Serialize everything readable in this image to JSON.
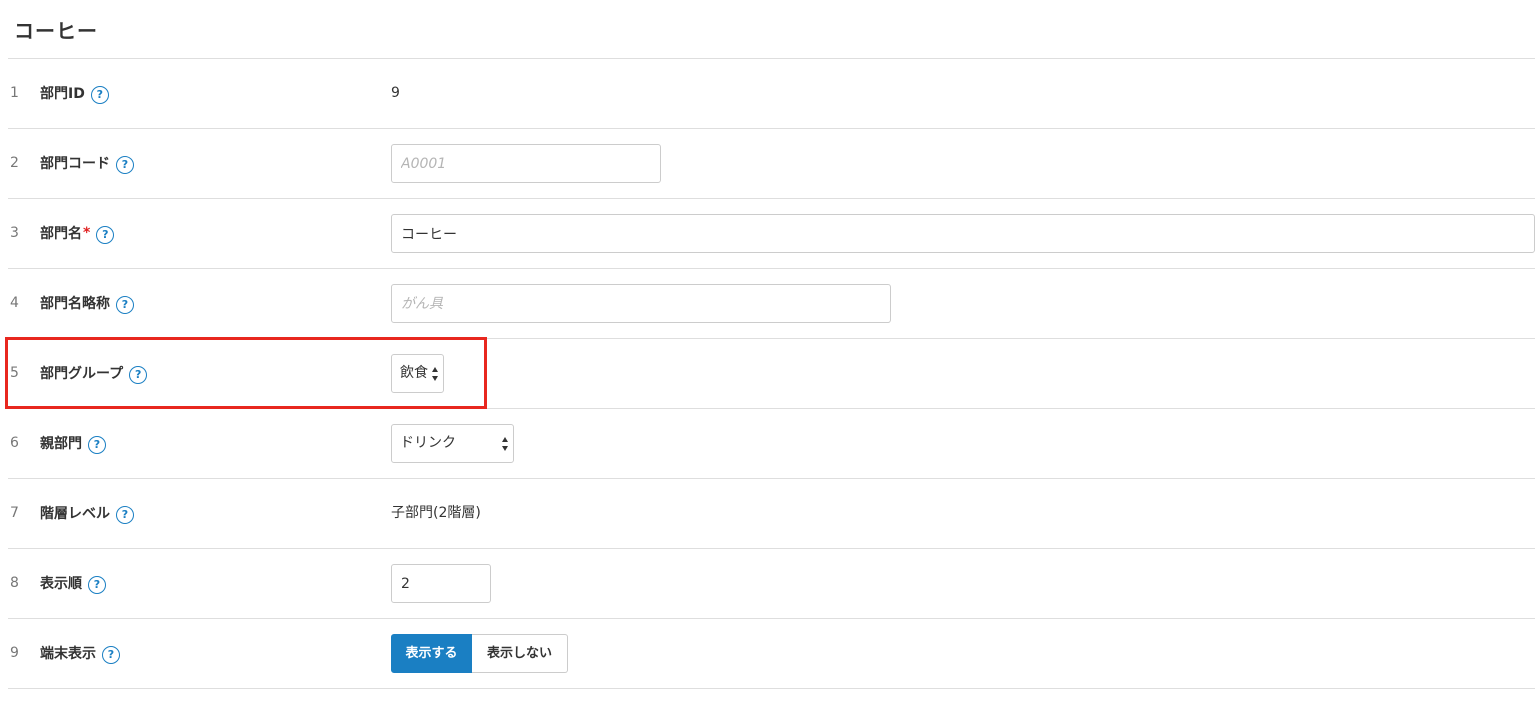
{
  "page_title": "コーヒー",
  "help_glyph": "?",
  "required_mark": "*",
  "accent_color": "#1a7fc3",
  "rows": [
    {
      "num": "1",
      "label": "部門ID",
      "value": "9"
    },
    {
      "num": "2",
      "label": "部門コード",
      "value": "",
      "placeholder": "A0001"
    },
    {
      "num": "3",
      "label": "部門名",
      "value": "コーヒー"
    },
    {
      "num": "4",
      "label": "部門名略称",
      "value": "",
      "placeholder": "がん具"
    },
    {
      "num": "5",
      "label": "部門グループ",
      "selected": "飲食"
    },
    {
      "num": "6",
      "label": "親部門",
      "selected": "ドリンク"
    },
    {
      "num": "7",
      "label": "階層レベル",
      "value": "子部門(2階層)"
    },
    {
      "num": "8",
      "label": "表示順",
      "value": "2"
    },
    {
      "num": "9",
      "label": "端末表示",
      "options": [
        "表示する",
        "表示しない"
      ],
      "selected": "表示する"
    }
  ]
}
